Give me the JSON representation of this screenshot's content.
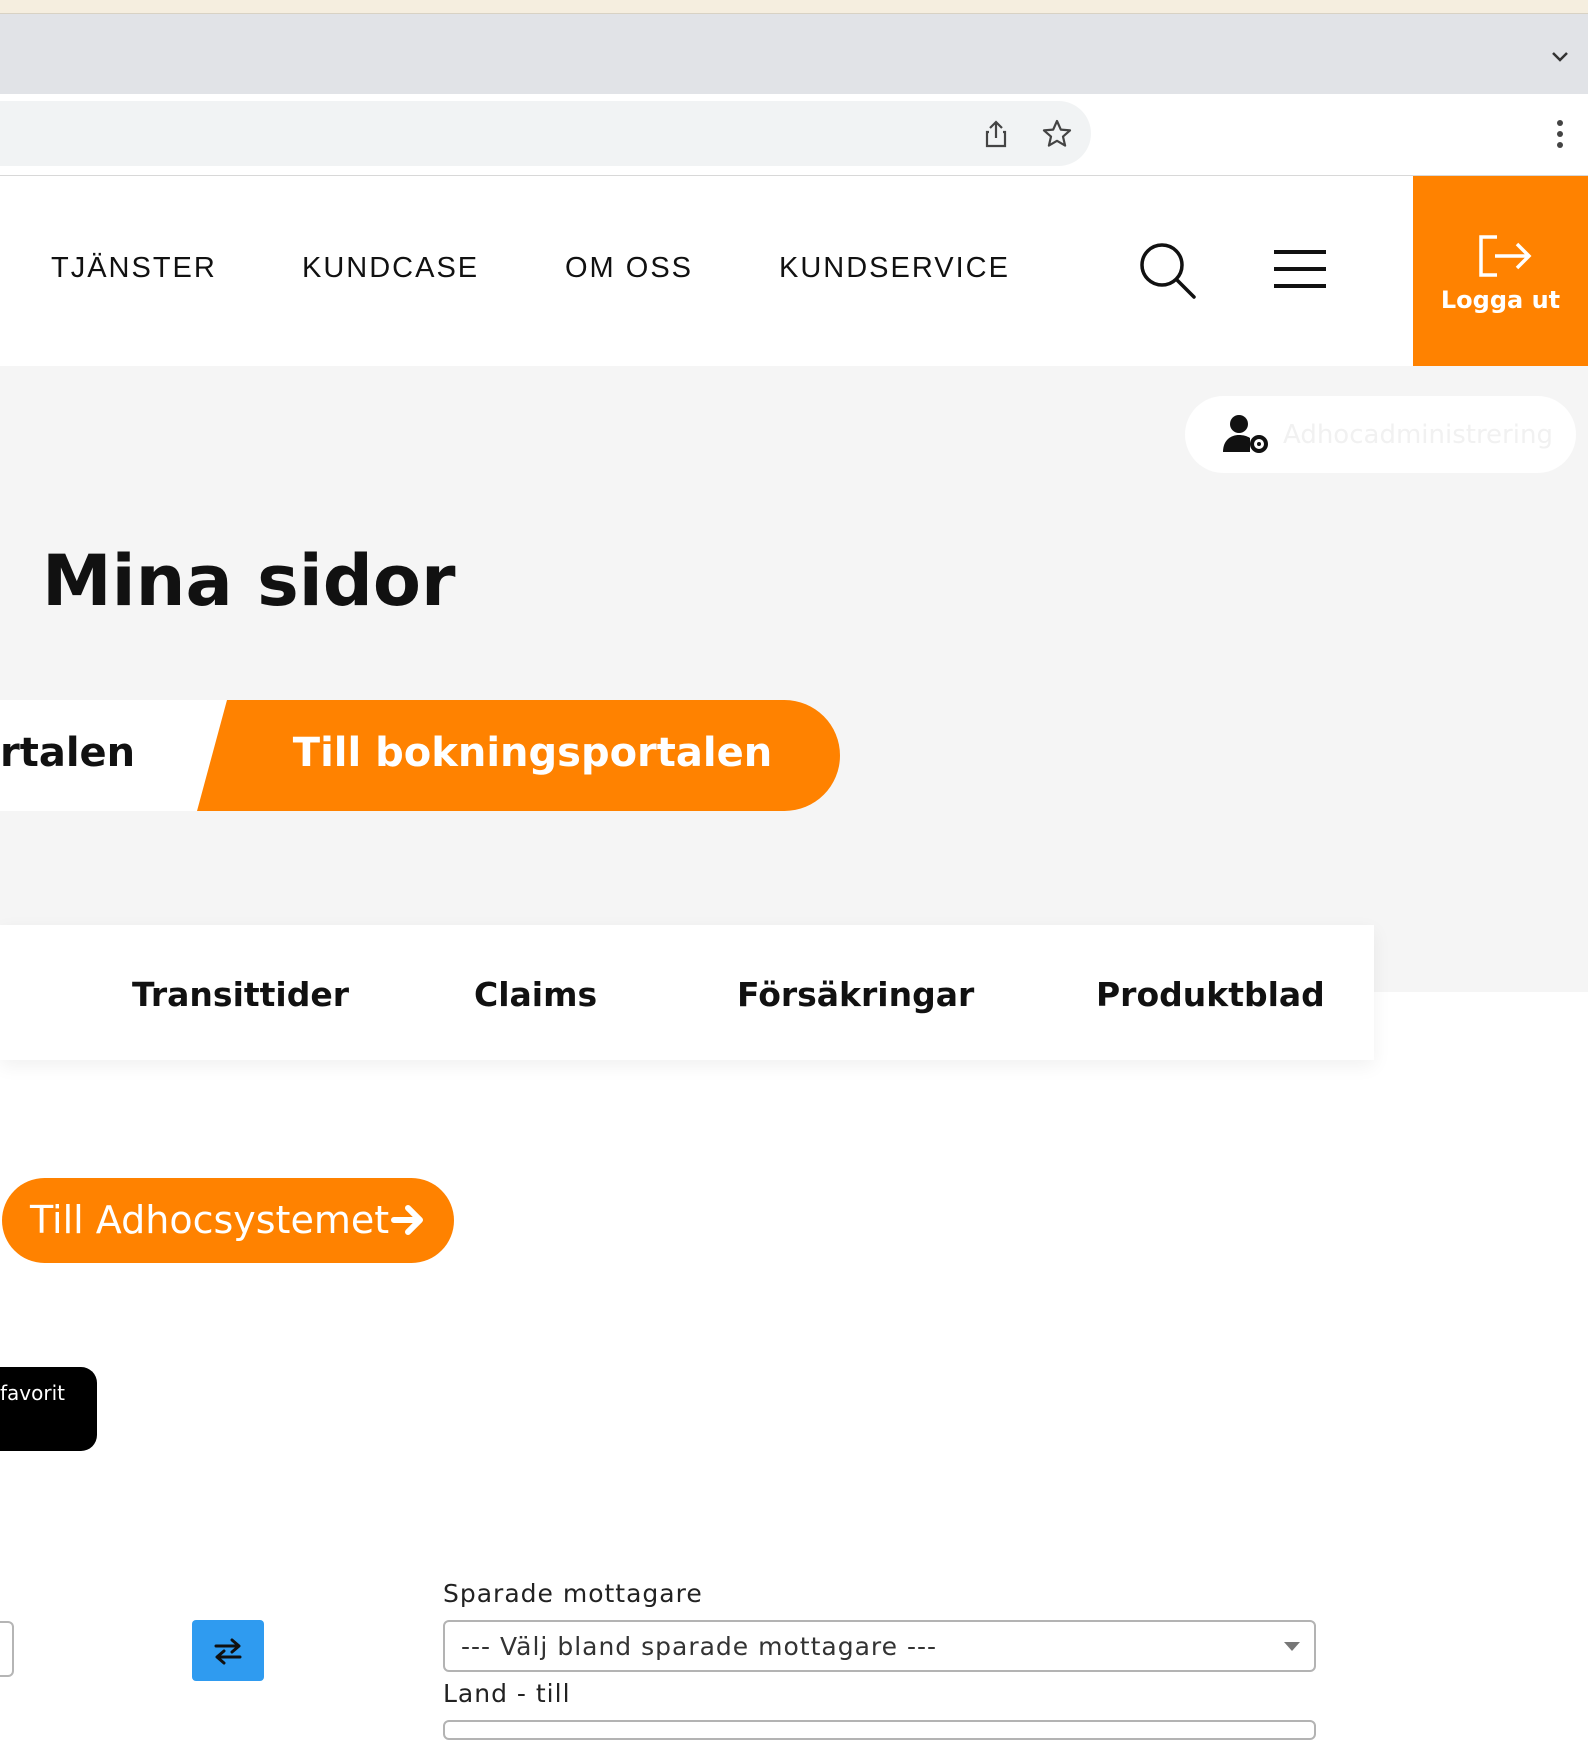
{
  "colors": {
    "accent": "#ff8200",
    "swap_button": "#2f9bf0",
    "hero_bg": "#f5f5f5",
    "tab_bar": "#e1e3e7"
  },
  "browser": {
    "icons": [
      "chevron-down-icon",
      "share-icon",
      "star-icon",
      "kebab-menu-icon"
    ]
  },
  "header": {
    "nav": [
      "TJÄNSTER",
      "KUNDCASE",
      "OM OSS",
      "KUNDSERVICE"
    ],
    "logout_label": "Logga ut",
    "icons": [
      "search-icon",
      "hamburger-menu-icon",
      "logout-icon"
    ]
  },
  "hero": {
    "admin_label": "Adhocadministrering",
    "title": "Mina sidor",
    "portal_left_label": "rtalen",
    "portal_right_label": "Till bokningsportalen"
  },
  "tabs": [
    "Transittider",
    "Claims",
    "Försäkringar",
    "Produktblad"
  ],
  "actions": {
    "adhoc_label": "Till Adhocsystemet",
    "favorit_label": "favorit"
  },
  "form": {
    "saved_recipients_label": "Sparade mottagare",
    "saved_recipients_value": "--- Välj bland sparade mottagare ---",
    "country_to_label": "Land - till"
  }
}
